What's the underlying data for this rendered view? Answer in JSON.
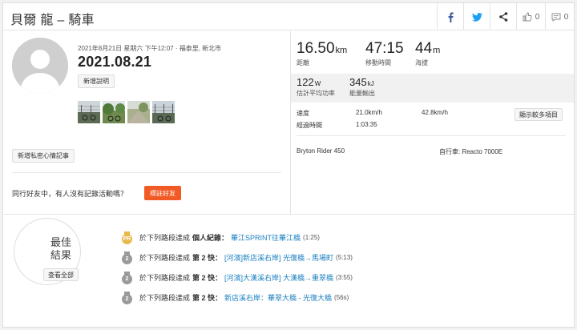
{
  "header": {
    "title": "貝爾 龍 – 騎車",
    "kudos_count": "0",
    "comment_count": "0"
  },
  "activity": {
    "meta": "2021年8月21日 星期六 下午12:07 · 福泰里, 新北市",
    "name": "2021.08.21",
    "add_description_label": "新增說明",
    "add_private_note_label": "新增私密心情記事",
    "photo_count": 4
  },
  "friends": {
    "prompt": "同行好友中，有人沒有記錄活動嗎？",
    "tag_label": "標註好友"
  },
  "stats": {
    "distance": {
      "value": "16.50",
      "unit": "km",
      "label": "距離"
    },
    "moving_time": {
      "value": "47:15",
      "label": "移動時間"
    },
    "elevation": {
      "value": "44",
      "unit": "m",
      "label": "海拔"
    },
    "power": {
      "value": "122",
      "unit": "W",
      "label": "估計平均功率"
    },
    "energy": {
      "value": "345",
      "unit": "kJ",
      "label": "能量輸出"
    }
  },
  "details": {
    "speed_label": "速度",
    "avg_speed": "21.0km/h",
    "max_speed": "42.8km/h",
    "elapsed_label": "經過時間",
    "elapsed_time": "1:03:35",
    "show_more_label": "顯示較多項目",
    "device": "Bryton Rider 450",
    "bike": "自行車: Reacto 7000E"
  },
  "best_efforts": {
    "title": "最佳結果",
    "view_all_label": "查看全部",
    "items": [
      {
        "medal": "PR",
        "medal_color": "#e8b84a",
        "prefix": "於下列路段達成",
        "rank": "個人紀錄：",
        "segment": "華江SPRINT往華江橋",
        "time": "(1:25)"
      },
      {
        "medal": "2",
        "medal_color": "#9a9a9a",
        "prefix": "於下列路段達成",
        "rank": "第 2 快：",
        "segment": "[河濱]新店溪右岸] 光復橋→馬場町",
        "time": "(5:13)"
      },
      {
        "medal": "2",
        "medal_color": "#9a9a9a",
        "prefix": "於下列路段達成",
        "rank": "第 2 快：",
        "segment": "[河濱]大漢溪右岸] 大漢橋→重翠橋",
        "time": "(3:55)"
      },
      {
        "medal": "2",
        "medal_color": "#9a9a9a",
        "prefix": "於下列路段達成",
        "rank": "第 2 快：",
        "segment": "新店溪右岸：華翠大橋 - 光復大橋",
        "time": "(56s)"
      }
    ]
  },
  "colors": {
    "accent": "#f15a24",
    "link": "#1a7fc1",
    "facebook": "#3b5998",
    "twitter": "#1da1f2"
  }
}
